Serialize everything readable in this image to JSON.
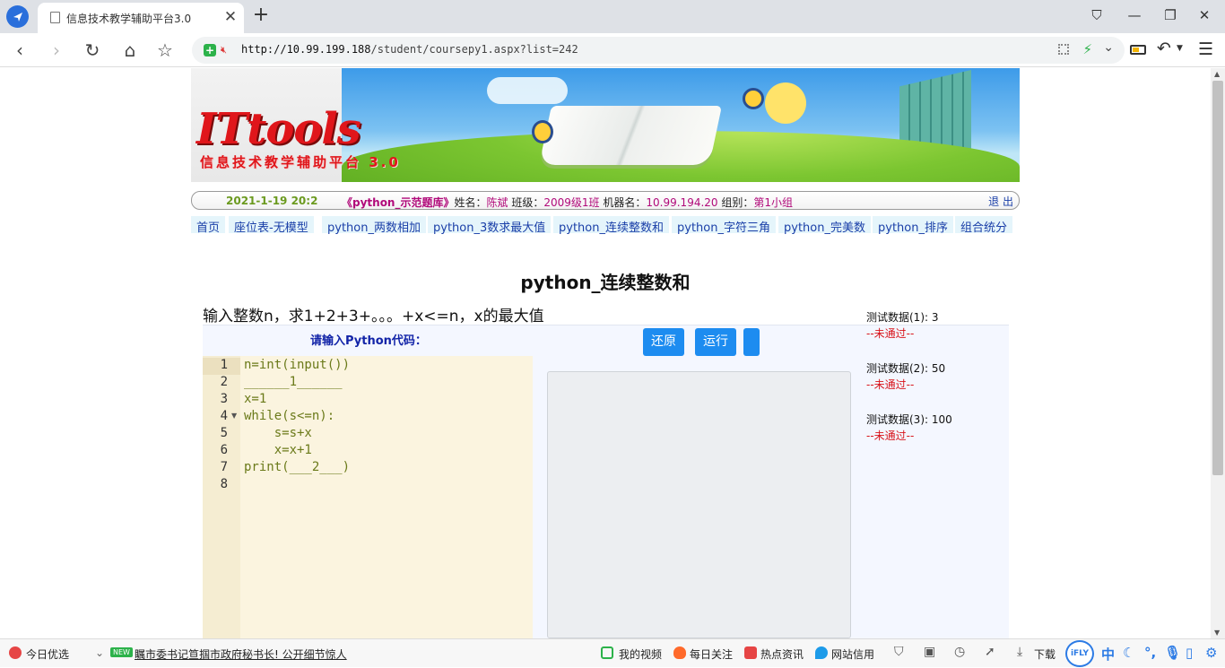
{
  "browser": {
    "tab_title": "信息技术教学辅助平台3.0",
    "tab_close": "✕",
    "new_tab": "+",
    "url_host": "http://10.99.199.188",
    "url_path": "/student/coursepy1.aspx?list=242",
    "window_controls": {
      "pin": "⛉",
      "minimize": "—",
      "restore": "❐",
      "close": "✕"
    },
    "nav_icons": {
      "back": "‹",
      "forward": "›",
      "reload": "↻",
      "home": "⌂",
      "star": "☆"
    }
  },
  "banner": {
    "logo": "ITtools",
    "subtitle": "信息技术教学辅助平台 3.0"
  },
  "infobar": {
    "datetime": "2021-1-19 20:2",
    "bank": "《python_示范题库》",
    "name_label": "姓名：",
    "name": "陈斌",
    "class_label": "班级：",
    "class": "2009级1班",
    "machine_label": "机器名：",
    "machine": "10.99.194.20",
    "group_label": "组别：",
    "group": "第1小组",
    "logout": "退 出"
  },
  "nav": {
    "items": [
      "首页",
      "座位表-无模型",
      "python_两数相加",
      "python_3数求最大值",
      "python_连续整数和",
      "python_字符三角",
      "python_完美数",
      "python_排序",
      "组合统分"
    ]
  },
  "problem": {
    "title": "python_连续整数和",
    "description": "输入整数n，求1+2+3+。。。+x<=n，x的最大值",
    "code_prompt": "请输入Python代码：",
    "buttons": {
      "reset": "还原",
      "run": "运行",
      "extra": ""
    }
  },
  "editor": {
    "line_numbers": [
      "1",
      "2",
      "3",
      "4",
      "5",
      "6",
      "7",
      "8"
    ],
    "lines": [
      "n=int(input())",
      "______1______",
      "x=1",
      "while(s<=n):",
      "    s=s+x",
      "    x=x+1",
      "print(___2___)",
      ""
    ]
  },
  "tests": [
    {
      "label": "测试数据(1): 3",
      "status": "--未通过--"
    },
    {
      "label": "测试数据(2): 50",
      "status": "--未通过--"
    },
    {
      "label": "测试数据(3): 100",
      "status": "--未通过--"
    }
  ],
  "statusbar": {
    "left_label": "今日优选",
    "new_badge": "NEW",
    "headline": "瞩市委书记笪掴市政府秘书长! 公开细节惊人",
    "items": [
      "我的视频",
      "每日关注",
      "热点资讯",
      "网站信用"
    ],
    "download": "下载",
    "ifly": "iFLY",
    "ifly_lang": "中"
  },
  "colors": {
    "accent_button": "#1d8cf0",
    "fail_red": "#d8141b",
    "info_magenta": "#b10a7a",
    "link_blue": "#1a3fa8"
  }
}
